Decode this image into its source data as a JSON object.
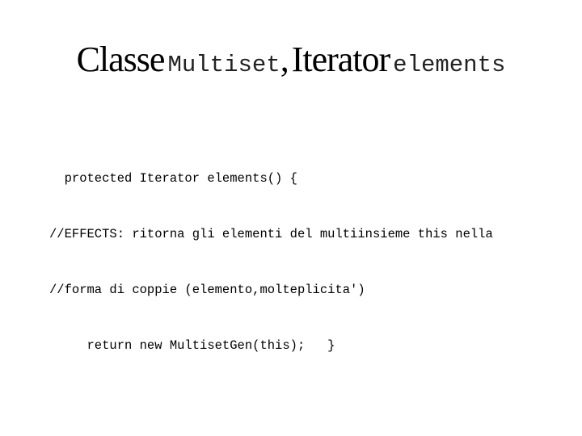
{
  "slide": {
    "title": {
      "part1": "Classe",
      "part2": "Multiset",
      "part3": ",",
      "part4": "Iterator",
      "part5": "elements"
    },
    "code_lines": [
      "  protected Iterator elements() {",
      "//EFFECTS: ritorna gli elementi del multiinsieme this nella",
      "//forma di coppie (elemento,molteplicita')",
      "     return new MultisetGen(this);   }"
    ]
  }
}
